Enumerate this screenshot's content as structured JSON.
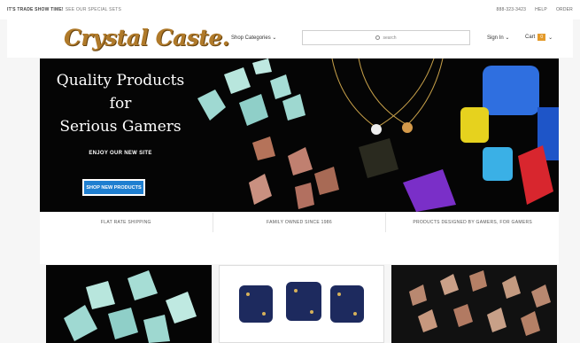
{
  "topbar": {
    "promo": "IT'S TRADE SHOW TIME!",
    "promo_link": "SEE OUR SPECIAL SETS",
    "phone": "888-323-3423",
    "help": "HELP",
    "order": "ORDER"
  },
  "header": {
    "logo": "Crystal Caste.",
    "shop_categories": "Shop Categories",
    "search_placeholder": "search",
    "sign_in": "Sign In",
    "cart_label": "Cart",
    "cart_count": "0"
  },
  "hero": {
    "title_line1": "Quality Products",
    "title_line2": "for",
    "title_line3": "Serious Gamers",
    "subtitle": "ENJOY OUR NEW SITE",
    "button": "SHOP NEW PRODUCTS"
  },
  "features": [
    "FLAT RATE SHIPPING",
    "FAMILY OWNED SINCE 1986",
    "PRODUCTS DESIGNED BY GAMERS, FOR GAMERS"
  ],
  "colors": {
    "brand_gold": "#b07a2a",
    "cart_badge": "#e49a2a",
    "cta_blue": "#1f7fd0"
  }
}
